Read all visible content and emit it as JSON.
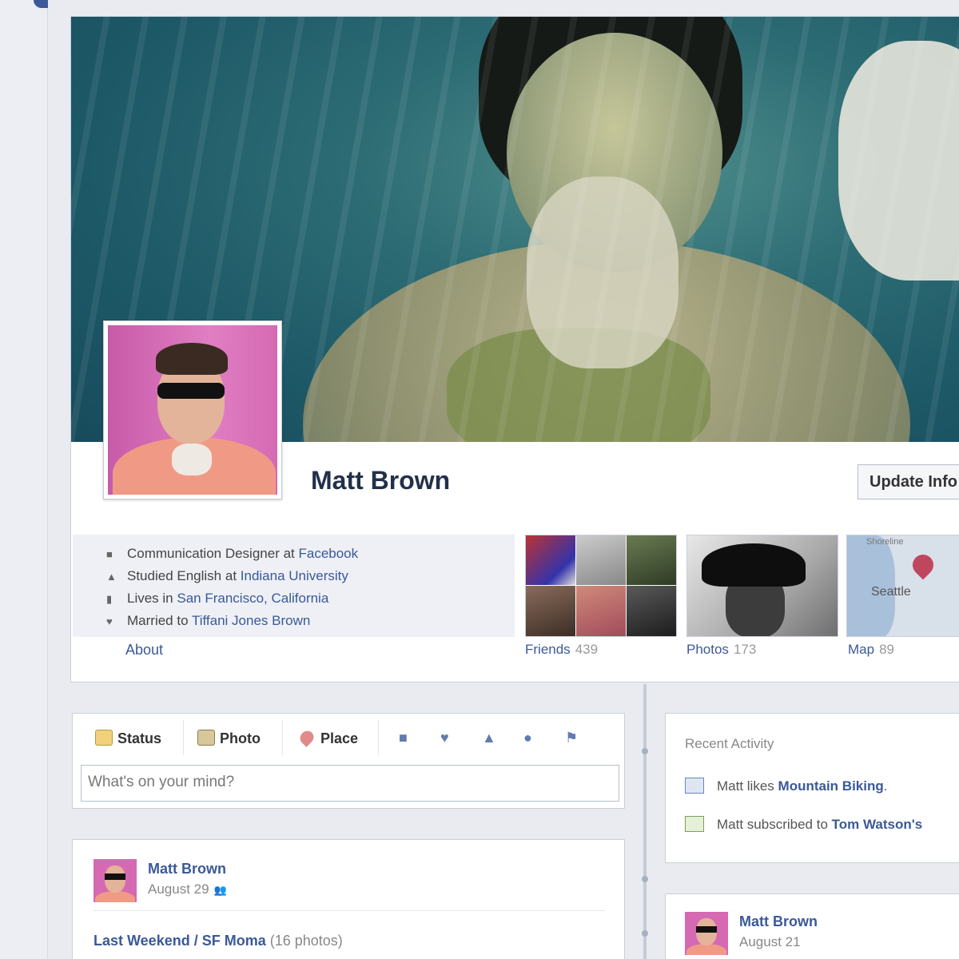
{
  "profile": {
    "name": "Matt Brown",
    "update_info_label": "Update Info"
  },
  "info": {
    "items": [
      {
        "icon": "briefcase-icon",
        "prefix": "Communication Designer at ",
        "link": "Facebook"
      },
      {
        "icon": "graduation-cap-icon",
        "prefix": "Studied English at ",
        "link": "Indiana University"
      },
      {
        "icon": "city-icon",
        "prefix": "Lives in ",
        "link": "San Francisco, California"
      },
      {
        "icon": "heart-icon",
        "prefix": "Married to ",
        "link": "Tiffani Jones Brown"
      }
    ],
    "about_label": "About"
  },
  "tiles": {
    "friends": {
      "label": "Friends",
      "count": "439"
    },
    "photos": {
      "label": "Photos",
      "count": "173"
    },
    "map": {
      "label": "Map",
      "count": "89",
      "place": "Seattle",
      "shore": "Shoreline"
    }
  },
  "composer": {
    "tabs": [
      "Status",
      "Photo",
      "Place"
    ],
    "placeholder": "What's on your mind?"
  },
  "post": {
    "author": "Matt Brown",
    "date": "August 29",
    "album_link": "Last Weekend / SF Moma",
    "album_count": "(16 photos)"
  },
  "activity": {
    "title": "Recent Activity",
    "items": [
      {
        "prefix": "Matt likes ",
        "link": "Mountain Biking",
        "suffix": "."
      },
      {
        "prefix": "Matt subscribed to ",
        "link": "Tom Watson's",
        "suffix": ""
      }
    ]
  },
  "post2": {
    "author": "Matt Brown",
    "date": "August 21"
  },
  "colors": {
    "brand": "#3b5998",
    "background": "#e9ebf0"
  }
}
